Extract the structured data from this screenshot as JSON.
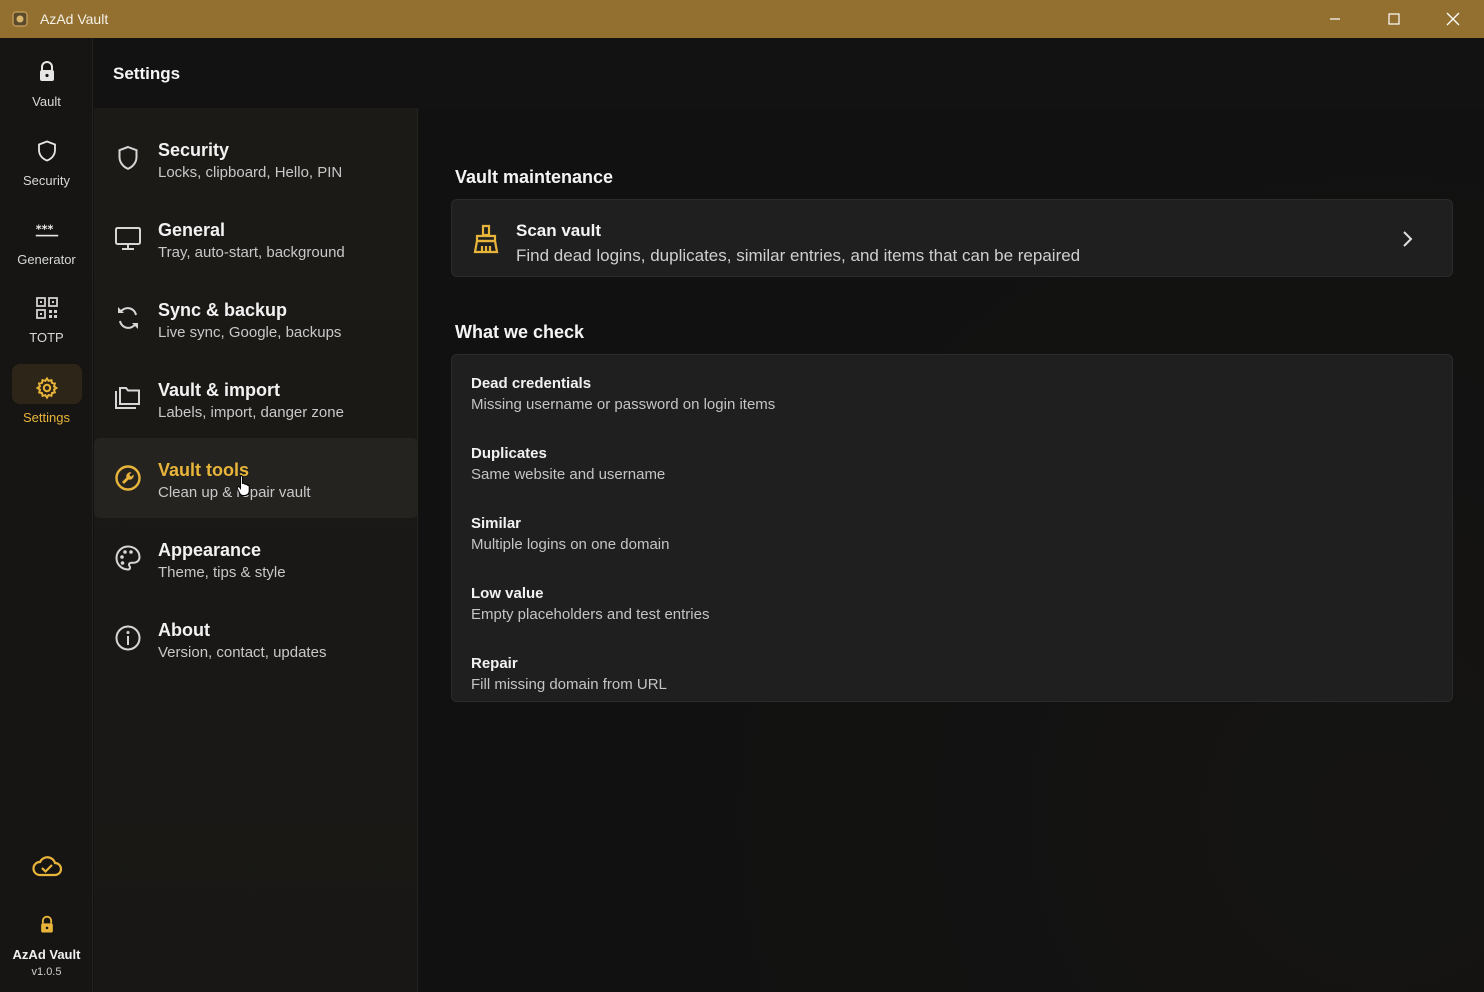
{
  "window": {
    "title": "AzAd Vault"
  },
  "rail": {
    "items": [
      {
        "label": "Vault",
        "icon": "lock-icon"
      },
      {
        "label": "Security",
        "icon": "shield-icon"
      },
      {
        "label": "Generator",
        "icon": "password-dots-icon"
      },
      {
        "label": "TOTP",
        "icon": "qr-code-icon"
      },
      {
        "label": "Settings",
        "icon": "gear-icon",
        "active": true
      }
    ],
    "footer": {
      "name": "AzAd Vault",
      "version": "v1.0.5"
    }
  },
  "header": {
    "title": "Settings"
  },
  "nav": {
    "items": [
      {
        "title": "Security",
        "subtitle": "Locks, clipboard, Hello, PIN",
        "icon": "shield-icon"
      },
      {
        "title": "General",
        "subtitle": "Tray, auto-start, background",
        "icon": "monitor-icon"
      },
      {
        "title": "Sync & backup",
        "subtitle": "Live sync, Google, backups",
        "icon": "sync-icon"
      },
      {
        "title": "Vault & import",
        "subtitle": "Labels, import, danger zone",
        "icon": "folders-icon"
      },
      {
        "title": "Vault tools",
        "subtitle": "Clean up & repair vault",
        "icon": "wrench-icon",
        "active": true
      },
      {
        "title": "Appearance",
        "subtitle": "Theme, tips & style",
        "icon": "palette-icon"
      },
      {
        "title": "About",
        "subtitle": "Version, contact, updates",
        "icon": "info-icon"
      }
    ]
  },
  "main": {
    "maintenance_title": "Vault maintenance",
    "scan": {
      "title": "Scan vault",
      "subtitle": "Find dead logins, duplicates, similar entries, and items that can be repaired"
    },
    "checks_title": "What we check",
    "checks": [
      {
        "title": "Dead credentials",
        "subtitle": "Missing username or password on login items"
      },
      {
        "title": "Duplicates",
        "subtitle": "Same website and username"
      },
      {
        "title": "Similar",
        "subtitle": "Multiple logins on one domain"
      },
      {
        "title": "Low value",
        "subtitle": "Empty placeholders and test entries"
      },
      {
        "title": "Repair",
        "subtitle": "Fill missing domain from URL"
      }
    ]
  },
  "colors": {
    "accent": "#e8b53a",
    "titlebar": "#93702f",
    "background": "#121212"
  }
}
